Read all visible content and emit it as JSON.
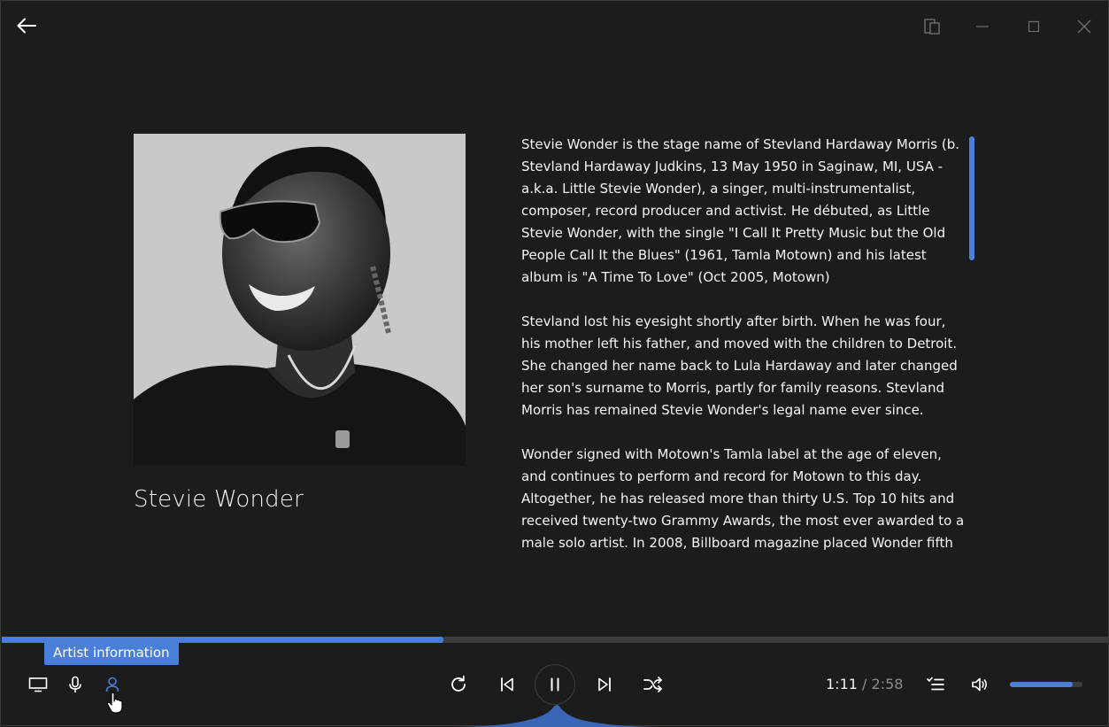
{
  "window": {
    "back_icon": "arrow-left-icon",
    "controls": [
      "compact-overlay-icon",
      "minimize-icon",
      "maximize-icon",
      "close-icon"
    ]
  },
  "artist": {
    "name": "Stevie Wonder",
    "photo_alt": "Stevie Wonder"
  },
  "bio": {
    "paragraphs": [
      "Stevie Wonder is the stage name of Stevland Hardaway Morris (b. Stevland Hardaway Judkins, 13 May 1950 in Saginaw, MI, USA - a.k.a. Little Stevie Wonder), a singer, multi-instrumentalist, composer, record producer and activist. He débuted, as Little Stevie Wonder, with the single \"I Call It Pretty Music but the Old People Call It the Blues\" (1961, Tamla Motown) and his latest album is \"A Time To Love\" (Oct 2005, Motown)",
      "Stevland lost his eyesight shortly after birth. When he was four, his mother left his father, and moved with the children to Detroit. She changed her name back to Lula Hardaway and later changed her son's surname to Morris, partly for family reasons. Stevland Morris has remained Stevie Wonder's legal name ever since.",
      "Wonder signed with Motown's Tamla label at the age of eleven, and continues to perform and record for Motown to this day. Altogether, he has released more than thirty U.S. Top 10 hits and received twenty-two Grammy Awards, the most ever awarded to a male solo artist. In 2008, Billboard magazine placed Wonder fifth"
    ]
  },
  "tooltip": {
    "text": "Artist information"
  },
  "playback": {
    "current_time": "1:11",
    "separator": "/",
    "total_time": "2:58",
    "progress": 0.399,
    "state": "playing"
  },
  "volume": {
    "level": 0.87
  },
  "colors": {
    "accent": "#4a7fd9",
    "background": "#1c1c1d",
    "text": "#ffffff",
    "muted": "#8e8e8e"
  },
  "icons": {
    "left": [
      "monitor-icon",
      "microphone-icon",
      "person-icon"
    ],
    "center": [
      "repeat-icon",
      "previous-icon",
      "pause-icon",
      "next-icon",
      "shuffle-icon"
    ],
    "right": [
      "queue-icon",
      "volume-icon"
    ]
  }
}
